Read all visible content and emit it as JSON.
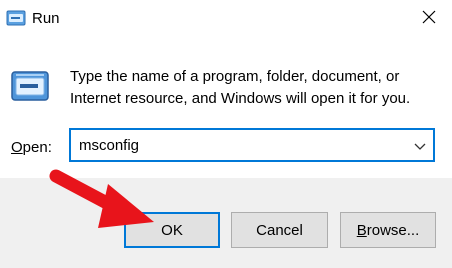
{
  "window": {
    "title": "Run"
  },
  "icons": {
    "app": "run-app-icon",
    "close": "close-icon",
    "program": "run-program-icon",
    "dropdown": "chevron-down-icon",
    "pointer": "red-arrow-annotation"
  },
  "dialog": {
    "description_line1": "Type the name of a program, folder, document, or",
    "description_line2": "Internet resource, and Windows will open it for you.",
    "open_label_access_key": "O",
    "open_label_rest": "pen:",
    "input_value": "msconfig"
  },
  "buttons": {
    "ok": "OK",
    "cancel": "Cancel",
    "browse_access_key": "B",
    "browse_rest": "rowse..."
  },
  "colors": {
    "accent": "#0078d7",
    "annotation": "#e8141b",
    "footer": "#f0f0f0"
  }
}
